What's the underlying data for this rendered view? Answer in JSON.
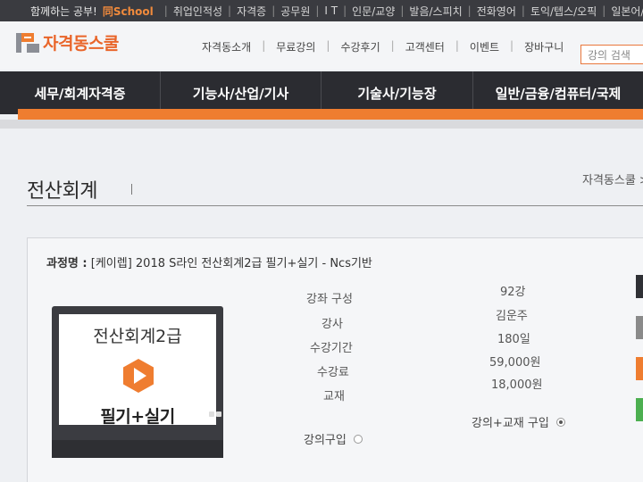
{
  "topbar": {
    "slogan": "함께하는 공부!",
    "brand": "同School",
    "links": [
      "취업인적성",
      "자격증",
      "공무원",
      "I T",
      "인문/교양",
      "발음/스피치",
      "전화영어",
      "토익/텝스/오픽",
      "일본어/JPT/JLPT"
    ]
  },
  "header": {
    "logo_text": "자격동스쿨",
    "nav": [
      "자격동소개",
      "무료강의",
      "수강후기",
      "고객센터",
      "이벤트",
      "장바구니"
    ],
    "search_placeholder": "강의 검색"
  },
  "categories": [
    "세무/회계자격증",
    "기능사/산업/기사",
    "기술사/기능장",
    "일반/금융/컴퓨터/국제"
  ],
  "page": {
    "title": "전산회계",
    "breadcrumb": "자격동스쿨 >"
  },
  "course": {
    "label": "과정명 :",
    "name": "[케이렙] 2018 S라인 전산회계2급 필기+실기 - Ncs기반"
  },
  "video": {
    "title": "전산회계2급",
    "subtitle": "필기+실기"
  },
  "info": {
    "rows": [
      {
        "label": "강좌 구성",
        "value": "92강"
      },
      {
        "label": "강사",
        "value": "김운주"
      },
      {
        "label": "수강기간",
        "value": "180일"
      },
      {
        "label": "수강료",
        "value": "59,000원"
      },
      {
        "label": "교재",
        "value": "18,000원"
      }
    ]
  },
  "purchase": {
    "lecture_only": "강의구입",
    "lecture_book": "강의+교재 구입",
    "selected": "lecture_book"
  },
  "colors": {
    "accent": "#ef7d30",
    "nav_dark": "#2b2c31",
    "side_buttons": [
      "#2f3035",
      "#8a8a8a",
      "#ef7d30",
      "#4caf50"
    ]
  }
}
